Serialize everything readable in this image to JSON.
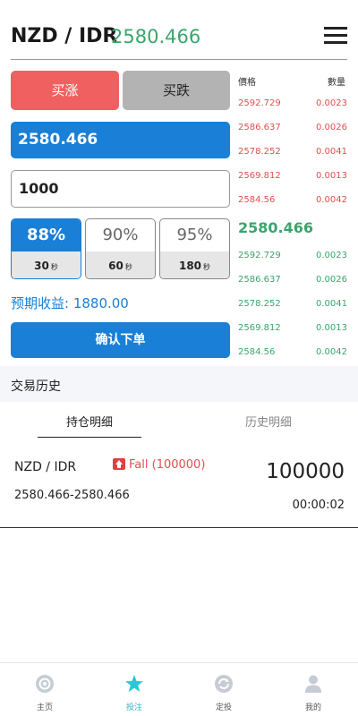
{
  "header": {
    "pair": "NZD / IDR",
    "price": "2580.466"
  },
  "trade": {
    "buy_up_label": "买涨",
    "buy_down_label": "买跌",
    "current_price": "2580.466",
    "amount": "1000",
    "options": [
      {
        "pct": "88%",
        "seconds": "30",
        "unit": "秒",
        "active": true
      },
      {
        "pct": "90%",
        "seconds": "60",
        "unit": "秒",
        "active": false
      },
      {
        "pct": "95%",
        "seconds": "180",
        "unit": "秒",
        "active": false
      }
    ],
    "expected_profit": "预期收益: 1880.00",
    "confirm_label": "确认下单"
  },
  "orderbook": {
    "price_header": "價格",
    "qty_header": "數量",
    "asks": [
      {
        "price": "2592.729",
        "qty": "0.0023"
      },
      {
        "price": "2586.637",
        "qty": "0.0026"
      },
      {
        "price": "2578.252",
        "qty": "0.0041"
      },
      {
        "price": "2569.812",
        "qty": "0.0013"
      },
      {
        "price": "2584.56",
        "qty": "0.0042"
      }
    ],
    "mid_price": "2580.466",
    "bids": [
      {
        "price": "2592.729",
        "qty": "0.0023"
      },
      {
        "price": "2586.637",
        "qty": "0.0026"
      },
      {
        "price": "2578.252",
        "qty": "0.0041"
      },
      {
        "price": "2569.812",
        "qty": "0.0013"
      },
      {
        "price": "2584.56",
        "qty": "0.0042"
      }
    ]
  },
  "history": {
    "title": "交易历史",
    "tabs": [
      "持仓明细",
      "历史明细"
    ],
    "position": {
      "pair": "NZD / IDR",
      "direction": "Fall",
      "direction_amount": "(100000)",
      "amount": "100000",
      "price_range": "2580.466-2580.466",
      "time": "00:00:02"
    }
  },
  "nav": {
    "items": [
      {
        "label": "主页",
        "icon": "home-icon"
      },
      {
        "label": "投注",
        "icon": "star-icon"
      },
      {
        "label": "定投",
        "icon": "refresh-icon"
      },
      {
        "label": "我的",
        "icon": "user-icon"
      }
    ],
    "active_color": "#2bb5c7"
  },
  "colors": {
    "accent": "#1a7fd6",
    "up": "#3aa56b",
    "down": "#e05050"
  }
}
